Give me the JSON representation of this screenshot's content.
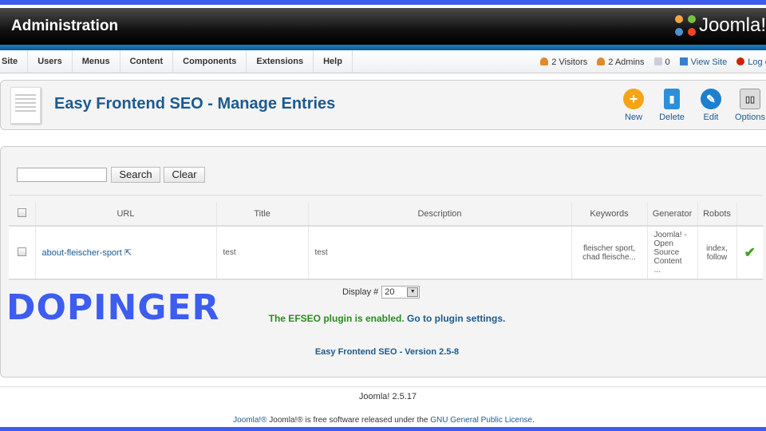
{
  "header": {
    "title": "Administration",
    "logo_text": "Joomla!"
  },
  "menu": [
    "Site",
    "Users",
    "Menus",
    "Content",
    "Components",
    "Extensions",
    "Help"
  ],
  "status": {
    "visitors": "2 Visitors",
    "admins": "2 Admins",
    "messages": "0",
    "view_site": "View Site",
    "logout": "Log out"
  },
  "toolbar": {
    "title": "Easy Frontend SEO - Manage Entries",
    "buttons": [
      {
        "label": "New",
        "icon": "plus-icon",
        "color": "#f5a417"
      },
      {
        "label": "Delete",
        "icon": "trash-icon",
        "color": "#2e8fd8"
      },
      {
        "label": "Edit",
        "icon": "pencil-icon",
        "color": "#1e7fd0"
      },
      {
        "label": "Options",
        "icon": "options-icon",
        "color": "#bbbbbb"
      }
    ]
  },
  "filter": {
    "search_value": "",
    "search_label": "Search",
    "clear_label": "Clear"
  },
  "table": {
    "headers": [
      "URL",
      "Title",
      "Description",
      "Keywords",
      "Generator",
      "Robots"
    ],
    "rows": [
      {
        "url": "about-fleischer-sport",
        "title": "test",
        "description": "test",
        "keywords": "fleischer sport, chad fleische...",
        "generator": "Joomla! - Open Source Content ...",
        "robots": "index, follow",
        "status": "enabled"
      }
    ]
  },
  "pagination": {
    "label": "Display #",
    "value": "20"
  },
  "plugin": {
    "enabled_text": "The EFSEO plugin is enabled.",
    "settings_link": "Go to plugin settings."
  },
  "version": "Easy Frontend SEO - Version 2.5-8",
  "watermark": "DOPINGER",
  "footer": {
    "version": "Joomla! 2.5.17",
    "license_prefix": "Joomla!® is free software released under the",
    "license_link": "GNU General Public License",
    "license_suffix": "."
  },
  "colors": {
    "accent": "#1d5a8e",
    "watermark": "#3d5cf0",
    "enabled": "#2a8a1f"
  }
}
